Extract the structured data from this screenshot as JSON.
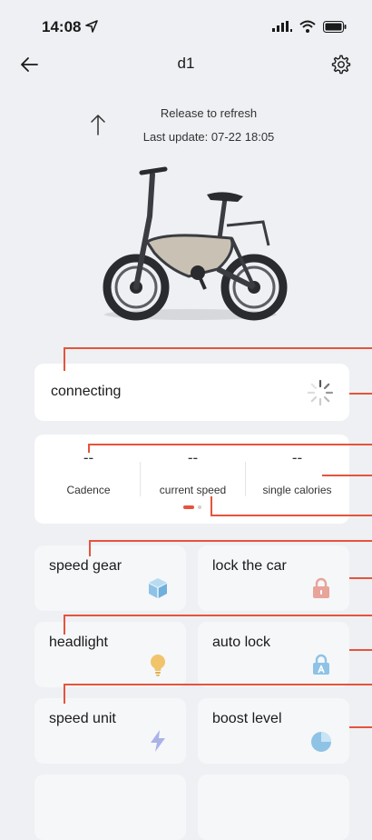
{
  "status": {
    "time": "14:08"
  },
  "nav": {
    "title": "d1"
  },
  "refresh": {
    "line1": "Release to refresh",
    "line2": "Last update: 07-22 18:05"
  },
  "connection": {
    "label": "connecting"
  },
  "stats": [
    {
      "value": "--",
      "label": "Cadence"
    },
    {
      "value": "--",
      "label": "current speed"
    },
    {
      "value": "--",
      "label": "single calories"
    }
  ],
  "tiles": [
    {
      "label": "speed gear",
      "icon": "cube-icon",
      "color": "#8ec3e6"
    },
    {
      "label": "lock the car",
      "icon": "lock-icon",
      "color": "#e8a39a"
    },
    {
      "label": "headlight",
      "icon": "bulb-icon",
      "color": "#f1c46b"
    },
    {
      "label": "auto lock",
      "icon": "auto-lock-icon",
      "color": "#8ec3e6"
    },
    {
      "label": "speed unit",
      "icon": "lightning-icon",
      "color": "#a9b3e8"
    },
    {
      "label": "boost level",
      "icon": "pie-icon",
      "color": "#8ec3e6"
    }
  ],
  "colors": {
    "accent": "#e5543d",
    "background": "#eef0f3"
  }
}
